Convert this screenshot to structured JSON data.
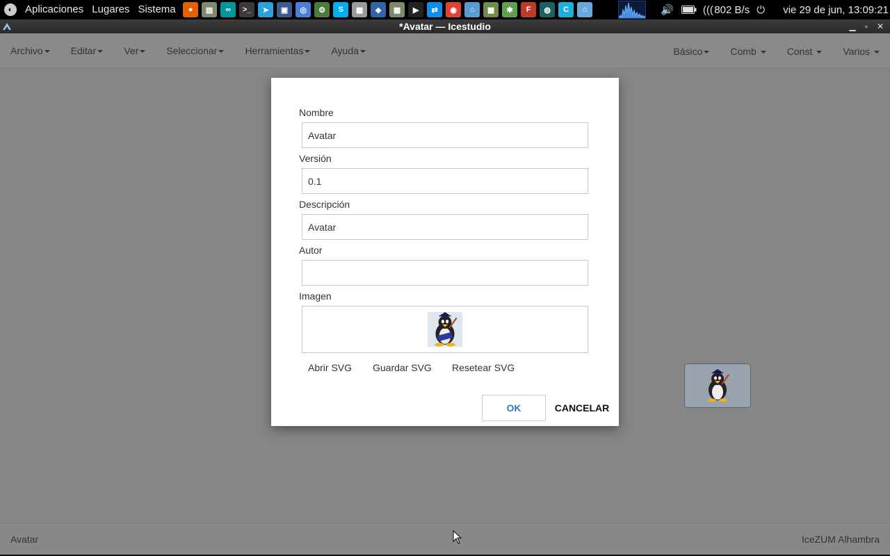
{
  "system_panel": {
    "menus": [
      "Aplicaciones",
      "Lugares",
      "Sistema"
    ],
    "launchers": [
      {
        "icon": "firefox-icon",
        "glyph": "●",
        "color": "#e66000"
      },
      {
        "icon": "file-manager-icon",
        "glyph": "▤",
        "color": "#7d8a6d"
      },
      {
        "icon": "arduino-icon",
        "glyph": "∞",
        "color": "#00979c"
      },
      {
        "icon": "terminal-icon",
        "glyph": ">_",
        "color": "#3a3a3a"
      },
      {
        "icon": "telegram-icon",
        "glyph": "➤",
        "color": "#2aa1da"
      },
      {
        "icon": "remote-desktop-icon",
        "glyph": "▣",
        "color": "#3b5b8c"
      },
      {
        "icon": "chromium-icon",
        "glyph": "◎",
        "color": "#4a7fd6"
      },
      {
        "icon": "system-monitor-icon",
        "glyph": "⚙",
        "color": "#4e7a3a"
      },
      {
        "icon": "skype-icon",
        "glyph": "S",
        "color": "#00aff0"
      },
      {
        "icon": "calculator-icon",
        "glyph": "▦",
        "color": "#9a9a9a"
      },
      {
        "icon": "virtualbox-icon",
        "glyph": "◈",
        "color": "#2f65a7"
      },
      {
        "icon": "spreadsheet-icon",
        "glyph": "▦",
        "color": "#7a8a6a"
      },
      {
        "icon": "media-player-icon",
        "glyph": "▶",
        "color": "#222222"
      },
      {
        "icon": "teamviewer-icon",
        "glyph": "⇄",
        "color": "#0e8ee9"
      },
      {
        "icon": "chrome-icon",
        "glyph": "◉",
        "color": "#db4437"
      },
      {
        "icon": "icestudio-icon",
        "glyph": "⌂",
        "color": "#5a9bd4"
      },
      {
        "icon": "image-viewer-icon",
        "glyph": "▩",
        "color": "#6f8a4a"
      },
      {
        "icon": "network-icon",
        "glyph": "✱",
        "color": "#5ea04e"
      },
      {
        "icon": "fritzing-icon",
        "glyph": "F",
        "color": "#c0392b"
      },
      {
        "icon": "vpn-icon",
        "glyph": "◍",
        "color": "#1e5f5f"
      },
      {
        "icon": "ccleaner-icon",
        "glyph": "C",
        "color": "#1eb0d8"
      },
      {
        "icon": "icestudio-icon",
        "glyph": "⌂",
        "color": "#6aa8e0"
      }
    ],
    "net_speed": "802 B/s",
    "clock": "vie 29 de jun, 13:09:21"
  },
  "window": {
    "title": "*Avatar — Icestudio"
  },
  "menubar": {
    "left": [
      "Archivo",
      "Editar",
      "Ver",
      "Seleccionar",
      "Herramientas",
      "Ayuda"
    ],
    "right": [
      "Básico",
      "Comb",
      "Const",
      "Varios"
    ]
  },
  "dialog": {
    "fields": {
      "nombre": {
        "label": "Nombre",
        "value": "Avatar"
      },
      "version": {
        "label": "Versión",
        "value": "0.1"
      },
      "descripcion": {
        "label": "Descripción",
        "value": "Avatar"
      },
      "autor": {
        "label": "Autor",
        "value": ""
      }
    },
    "image_label": "Imagen",
    "open_svg": "Abrir SVG",
    "save_svg": "Guardar SVG",
    "reset_svg": "Resetear SVG",
    "ok": "OK",
    "cancel": "CANCELAR"
  },
  "statusbar": {
    "left": "Avatar",
    "right": "IceZUM Alhambra"
  },
  "colors": {
    "accent": "#337ab7",
    "overlay": "#888888",
    "panel": "#000000"
  }
}
